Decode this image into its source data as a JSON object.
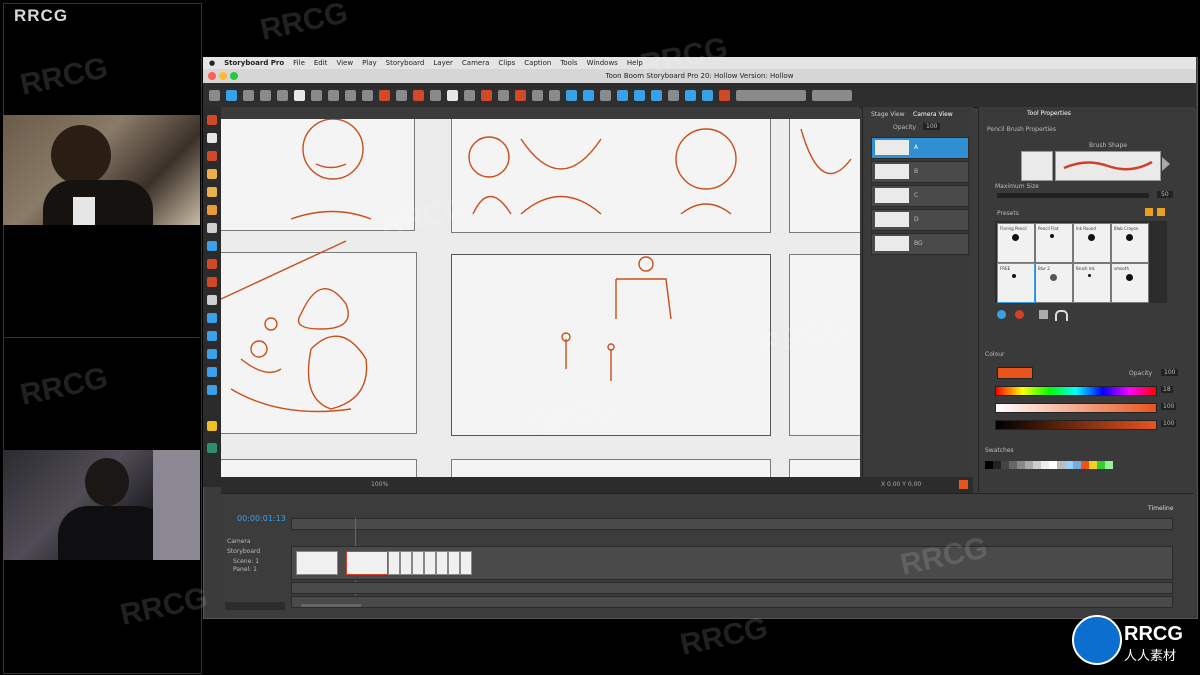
{
  "watermark": {
    "corner_label": "RRCG",
    "repeated_text": "RRCG",
    "logo_title": "RRCG",
    "logo_subtitle": "人人素材"
  },
  "mac_menu": [
    "Storyboard Pro",
    "File",
    "Edit",
    "View",
    "Play",
    "Storyboard",
    "Layer",
    "Camera",
    "Clips",
    "Caption",
    "Tools",
    "Windows",
    "Help"
  ],
  "window_title": "Toon Boom Storyboard Pro 20: Hollow Version: Hollow",
  "mid_panel": {
    "tabs": [
      "Stage View",
      "Camera View"
    ],
    "opacity_label": "Opacity",
    "opacity_value": "100"
  },
  "layers": [
    "A",
    "B",
    "C",
    "D",
    "BG"
  ],
  "props": {
    "tab_labels": [
      "Tool Properties"
    ],
    "section_title": "Pencil Brush Properties",
    "brush_label": "Brush Shape",
    "max_size_label": "Maximum Size",
    "max_size_value": "50",
    "presets_label": "Presets",
    "presets": [
      "Flaring Pencil",
      "Pencil Flat",
      "Ink Round",
      "Blob Crayon",
      "FREE",
      "Blur 2",
      "Brush Ink",
      "smooth"
    ],
    "colour_label": "Colour",
    "opacity_label": "Opacity",
    "opacity_value": "100",
    "swatches_label": "Swatches",
    "colour_values": [
      "18",
      "100",
      "100"
    ],
    "active_colour": "#e8541c"
  },
  "timeline": {
    "title": "Timeline",
    "track_label": "Camera",
    "storyboard_label": "Storyboard",
    "scene_label": "Scene: 1",
    "panel_label": "Panel: 1",
    "timecode": "00:00:01:13"
  },
  "stage_footer": {
    "zoom": "100%",
    "coords": "X 0.00 Y 0.00"
  }
}
